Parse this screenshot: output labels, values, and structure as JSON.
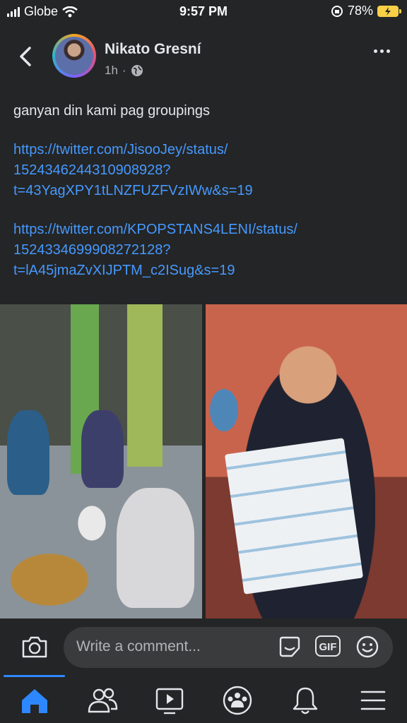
{
  "status_bar": {
    "carrier": "Globe",
    "time": "9:57 PM",
    "battery": "78%"
  },
  "post": {
    "author": "Nikato Gresní",
    "time_ago": "1h",
    "privacy_separator": "·",
    "text": "ganyan din kami pag groupings",
    "links": [
      "https://twitter.com/JisooJey/status/1524346244310908928?t=43YagXPY1tLNZFUZFVzIWw&s=19",
      "https://twitter.com/KPOPSTANS4LENI/status/1524334699908272128?t=lA45jmaZvXIJPTM_c2ISug&s=19"
    ],
    "link_lines": [
      [
        "https://twitter.com/JisooJey/status/",
        "1524346244310908928?",
        "t=43YagXPY1tLNZFUZFVzIWw&s=19"
      ],
      [
        "https://twitter.com/KPOPSTANS4LENI/status/",
        "1524334699908272128?",
        "t=lA45jmaZvXIJPTM_c2ISug&s=19"
      ]
    ]
  },
  "composer": {
    "placeholder": "Write a comment...",
    "gif_label": "GIF"
  },
  "icons": {
    "back": "chevron-left-icon",
    "globe": "globe-icon",
    "more": "more-horizontal-icon",
    "camera": "camera-icon",
    "sticker": "sticker-icon",
    "emoji": "emoji-icon",
    "tabs": [
      "home-icon",
      "friends-icon",
      "watch-icon",
      "groups-icon",
      "notifications-icon",
      "menu-icon"
    ]
  },
  "colors": {
    "background": "#242526",
    "link": "#4599ff",
    "accent": "#2d88ff"
  }
}
